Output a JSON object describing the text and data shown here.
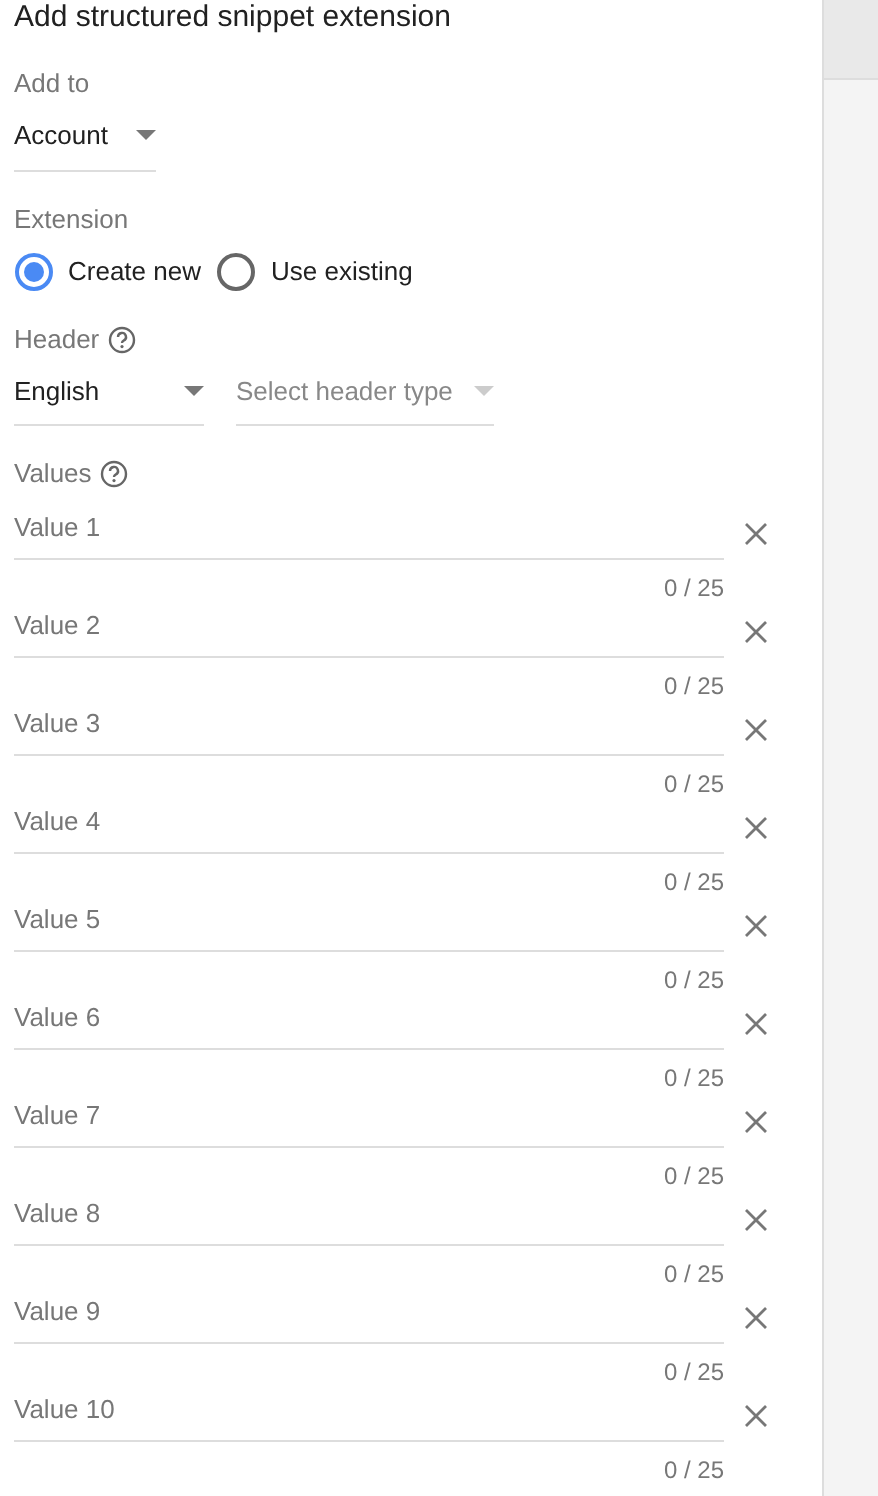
{
  "title": "Add structured snippet extension",
  "add_to": {
    "label": "Add to",
    "value": "Account"
  },
  "extension": {
    "label": "Extension",
    "options": [
      {
        "label": "Create new",
        "selected": true
      },
      {
        "label": "Use existing",
        "selected": false
      }
    ]
  },
  "header": {
    "label": "Header",
    "language": "English",
    "type_placeholder": "Select header type"
  },
  "values": {
    "label": "Values",
    "fields": [
      {
        "placeholder": "Value 1",
        "counter": "0 / 25"
      },
      {
        "placeholder": "Value 2",
        "counter": "0 / 25"
      },
      {
        "placeholder": "Value 3",
        "counter": "0 / 25"
      },
      {
        "placeholder": "Value 4",
        "counter": "0 / 25"
      },
      {
        "placeholder": "Value 5",
        "counter": "0 / 25"
      },
      {
        "placeholder": "Value 6",
        "counter": "0 / 25"
      },
      {
        "placeholder": "Value 7",
        "counter": "0 / 25"
      },
      {
        "placeholder": "Value 8",
        "counter": "0 / 25"
      },
      {
        "placeholder": "Value 9",
        "counter": "0 / 25"
      },
      {
        "placeholder": "Value 10",
        "counter": "0 / 25"
      }
    ]
  }
}
